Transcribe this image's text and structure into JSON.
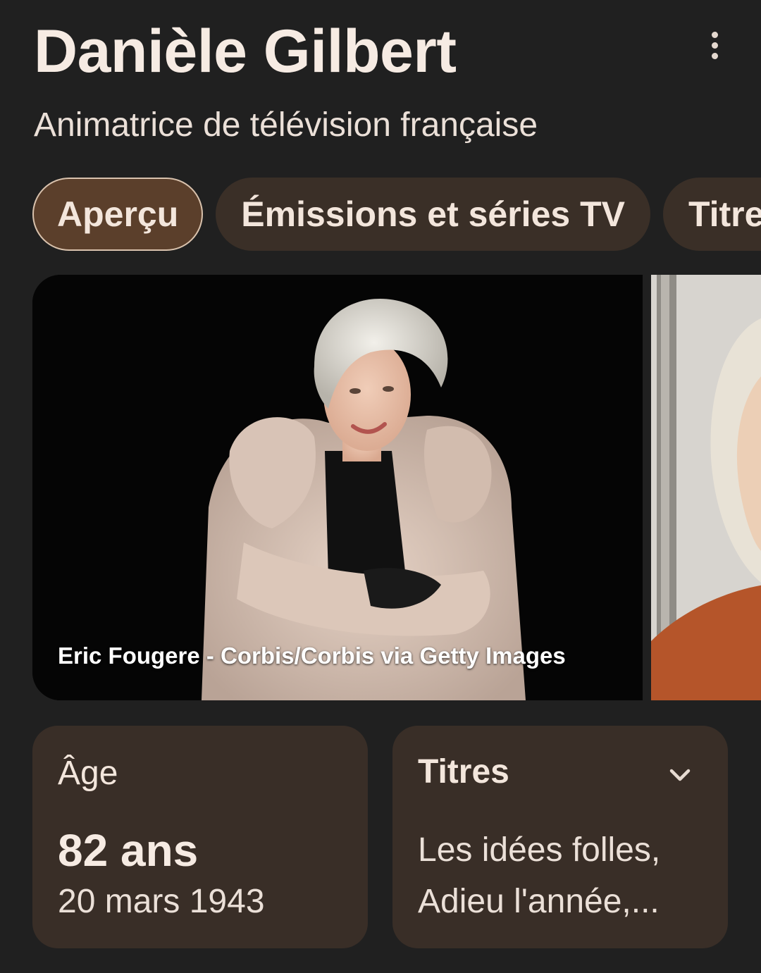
{
  "header": {
    "title": "Danièle Gilbert",
    "subtitle": "Animatrice de télévision française",
    "more_icon": "more-vert-icon"
  },
  "tabs": [
    {
      "label": "Aperçu",
      "active": true
    },
    {
      "label": "Émissions et séries TV",
      "active": false
    },
    {
      "label": "Titres",
      "active": false
    }
  ],
  "gallery": {
    "main_credit": "Eric Fougere - Corbis/Corbis via Getty Images"
  },
  "cards": {
    "age": {
      "label": "Âge",
      "value": "82 ans",
      "date": "20 mars 1943"
    },
    "titles": {
      "label": "Titres",
      "text": "Les idées folles, Adieu l'année,...",
      "expand_icon": "chevron-down-icon"
    }
  },
  "colors": {
    "background": "#202020",
    "chip": "#3a2f27",
    "chip_active": "#5b3f2b",
    "card": "#392e27",
    "text": "#f3e6dc"
  }
}
